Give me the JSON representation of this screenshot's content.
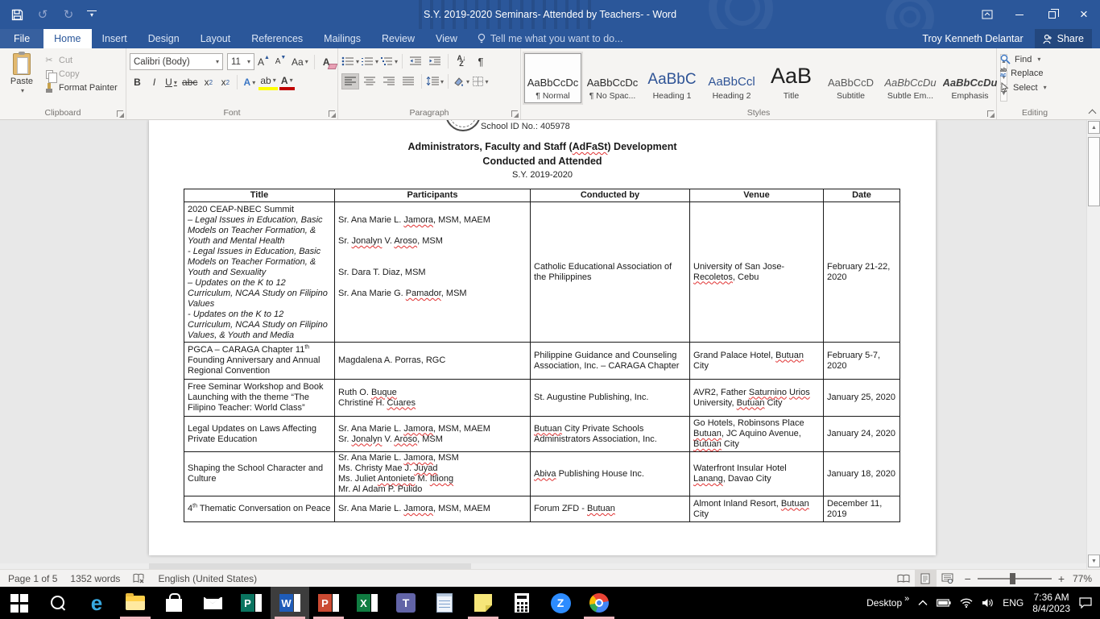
{
  "titlebar": {
    "title": "S.Y. 2019-2020 Seminars- Attended by Teachers- - Word"
  },
  "tabs": {
    "items": [
      {
        "label": "File",
        "file": true
      },
      {
        "label": "Home",
        "active": true
      },
      {
        "label": "Insert"
      },
      {
        "label": "Design"
      },
      {
        "label": "Layout"
      },
      {
        "label": "References"
      },
      {
        "label": "Mailings"
      },
      {
        "label": "Review"
      },
      {
        "label": "View"
      }
    ],
    "tell_me": "Tell me what you want to do...",
    "user": "Troy Kenneth Delantar",
    "share": "Share"
  },
  "ribbon": {
    "clipboard": {
      "label": "Clipboard",
      "paste": "Paste",
      "cut": "Cut",
      "copy": "Copy",
      "format_painter": "Format Painter"
    },
    "font": {
      "label": "Font",
      "family": "Calibri (Body)",
      "size": "11",
      "glyphs": {
        "bold": "B",
        "italic": "I",
        "underline": "U",
        "strike": "abc",
        "subscript": "x",
        "superscript": "x",
        "grow": "A",
        "shrink": "A",
        "change_case": "Aa",
        "clear": "A",
        "effects": "A",
        "highlight": "ab",
        "color": "A"
      }
    },
    "paragraph": {
      "label": "Paragraph",
      "glyphs": {
        "sort_a": "A",
        "sort_z": "Z",
        "pilcrow": "¶"
      }
    },
    "styles": {
      "label": "Styles",
      "items": [
        {
          "preview": "AaBbCcDc",
          "name": "¶ Normal",
          "size": 13,
          "color": "#2b2b2b",
          "selected": true
        },
        {
          "preview": "AaBbCcDc",
          "name": "¶ No Spac...",
          "size": 13,
          "color": "#2b2b2b"
        },
        {
          "preview": "AaBbC",
          "name": "Heading 1",
          "size": 19,
          "color": "#2f5496"
        },
        {
          "preview": "AaBbCcl",
          "name": "Heading 2",
          "size": 15,
          "color": "#2f5496"
        },
        {
          "preview": "AaB",
          "name": "Title",
          "size": 27,
          "color": "#1f1f1f"
        },
        {
          "preview": "AaBbCcD",
          "name": "Subtitle",
          "size": 13,
          "color": "#5a5a5a"
        },
        {
          "preview": "AaBbCcDu",
          "name": "Subtle Em...",
          "size": 13,
          "color": "#5a5a5a",
          "italic": true
        },
        {
          "preview": "AaBbCcDu",
          "name": "Emphasis",
          "size": 13,
          "color": "#3f3f3f",
          "italic": true,
          "bold": true
        }
      ]
    },
    "editing": {
      "label": "Editing",
      "find": "Find",
      "replace": "Replace",
      "select": "Select",
      "replace_glyphs": {
        "top": "ab",
        "bottom": "ac"
      }
    }
  },
  "document": {
    "school_id": "School ID No.: 405978",
    "heading": {
      "line1": "Administrators, Faculty and Staff (~{AdFaSt}) Development",
      "line2": "Conducted and Attended",
      "line3": "S.Y. 2019-2020"
    },
    "table": {
      "headers": [
        "Title",
        "Participants",
        "Conducted by",
        "Venue",
        "Date"
      ],
      "rows": [
        {
          "title": [
            {
              "t": "2020 CEAP-NBEC Summit"
            },
            {
              "t": "– Legal Issues in Education, Basic Models on Teacher Formation, & Youth and Mental Health",
              "i": true
            },
            {
              "t": "-  Legal Issues in Education,  Basic Models on Teacher Formation, & Youth and Sexuality",
              "i": true
            },
            {
              "t": "– Updates on the K to 12 Curriculum, NCAA Study on Filipino Values",
              "i": true
            },
            {
              "t": "-  Updates on the K to 12 Curriculum, NCAA Study on Filipino Values, & Youth and Media",
              "i": true
            }
          ],
          "participants": [
            "",
            "Sr. Ana Marie L. ~{Jamora}, MSM, MAEM",
            "",
            "Sr. ~{Jonalyn} V. ~{Aroso}, MSM",
            "",
            "",
            "Sr. Dara T. Diaz, MSM",
            "",
            "Sr. Ana Marie G. ~{Pamador}, MSM"
          ],
          "conducted": "Catholic Educational Association of the Philippines",
          "venue": "University of San Jose-~{Recoletos}, Cebu",
          "date": "February 21-22, 2020"
        },
        {
          "title": [
            {
              "t": "PGCA – CARAGA Chapter 11^{th} Founding Anniversary and Annual Regional Convention"
            }
          ],
          "participants": [
            "Magdalena A. Porras, RGC"
          ],
          "conducted": "Philippine Guidance and Counseling Association, Inc. – CARAGA Chapter",
          "venue": "Grand Palace Hotel, ~{Butuan} City",
          "date": "February 5-7, 2020"
        },
        {
          "title": [
            {
              "t": "Free Seminar Workshop and Book Launching with the theme “The Filipino Teacher: World Class”"
            }
          ],
          "participants": [
            "Ruth O. ~{Buque}",
            "Christine H. ~{Cuares}"
          ],
          "conducted": "St. Augustine Publishing, Inc.",
          "venue": "AVR2, Father ~{Saturnino} ~{Urios} University, ~{Butuan} City",
          "date": "January 25, 2020"
        },
        {
          "title": [
            {
              "t": "Legal Updates on Laws Affecting Private Education"
            }
          ],
          "participants": [
            "Sr. Ana Marie L. ~{Jamora}, MSM, MAEM",
            "Sr. ~{Jonalyn} V. ~{Aroso}, MSM"
          ],
          "conducted": "~{Butuan} City Private Schools Administrators Association, Inc.",
          "venue": "Go Hotels, Robinsons Place ~{Butuan}, JC Aquino Avenue, ~{Butuan} City",
          "date": "January 24, 2020"
        },
        {
          "title": [
            {
              "t": "Shaping the School Character and Culture"
            }
          ],
          "participants": [
            "Sr. Ana Marie L. ~{Jamora}, MSM",
            "Ms. Christy Mae J. ~{Juyad}",
            "Ms. Juliet ~{Antoniete} M. ~{Itliong}",
            "Mr. Al Adam P. Pulido"
          ],
          "conducted": "~{Abiva} Publishing House Inc.",
          "venue": "Waterfront Insular Hotel ~{Lanang}, Davao City",
          "date": "January 18, 2020"
        },
        {
          "title": [
            {
              "t": "4^{th} Thematic Conversation on Peace"
            }
          ],
          "participants": [
            "Sr. Ana Marie L. ~{Jamora}, MSM, MAEM"
          ],
          "conducted": "Forum ZFD - ~{Butuan}",
          "venue": "Almont Inland Resort, ~{Butuan} City",
          "date": "December 11, 2019"
        }
      ]
    }
  },
  "statusbar": {
    "page": "Page 1 of 5",
    "words": "1352 words",
    "language": "English (United States)",
    "zoom": "77%"
  },
  "taskbar": {
    "apps": [
      {
        "icon": "start"
      },
      {
        "icon": "search"
      },
      {
        "icon": "edge"
      },
      {
        "icon": "explorer",
        "indicator": true
      },
      {
        "icon": "store"
      },
      {
        "icon": "mail"
      },
      {
        "icon": "publisher"
      },
      {
        "icon": "word",
        "indicator": true,
        "active": true
      },
      {
        "icon": "powerpoint",
        "indicator": true
      },
      {
        "icon": "excel"
      },
      {
        "icon": "teams"
      },
      {
        "icon": "notepad"
      },
      {
        "icon": "stickynotes",
        "indicator": true
      },
      {
        "icon": "calculator"
      },
      {
        "icon": "zoom"
      },
      {
        "icon": "chrome",
        "indicator": true
      }
    ],
    "icon_glyphs": {
      "edge": "e",
      "publisher": "P",
      "word": "W",
      "powerpoint": "P",
      "excel": "X",
      "teams": "T",
      "zoom": "Z"
    },
    "tray": {
      "desktop": "Desktop",
      "overflow": "»",
      "lang": "ENG",
      "time": "7:36 AM",
      "date": "8/4/2023"
    }
  },
  "colors": {
    "accent": "#2b579a",
    "taskbar_indicator": "#f0b9c0",
    "squiggle_red": "#e03131",
    "heading_blue": "#2f5496",
    "highlight_yellow": "#ffff00",
    "font_color_red": "#c00000"
  }
}
